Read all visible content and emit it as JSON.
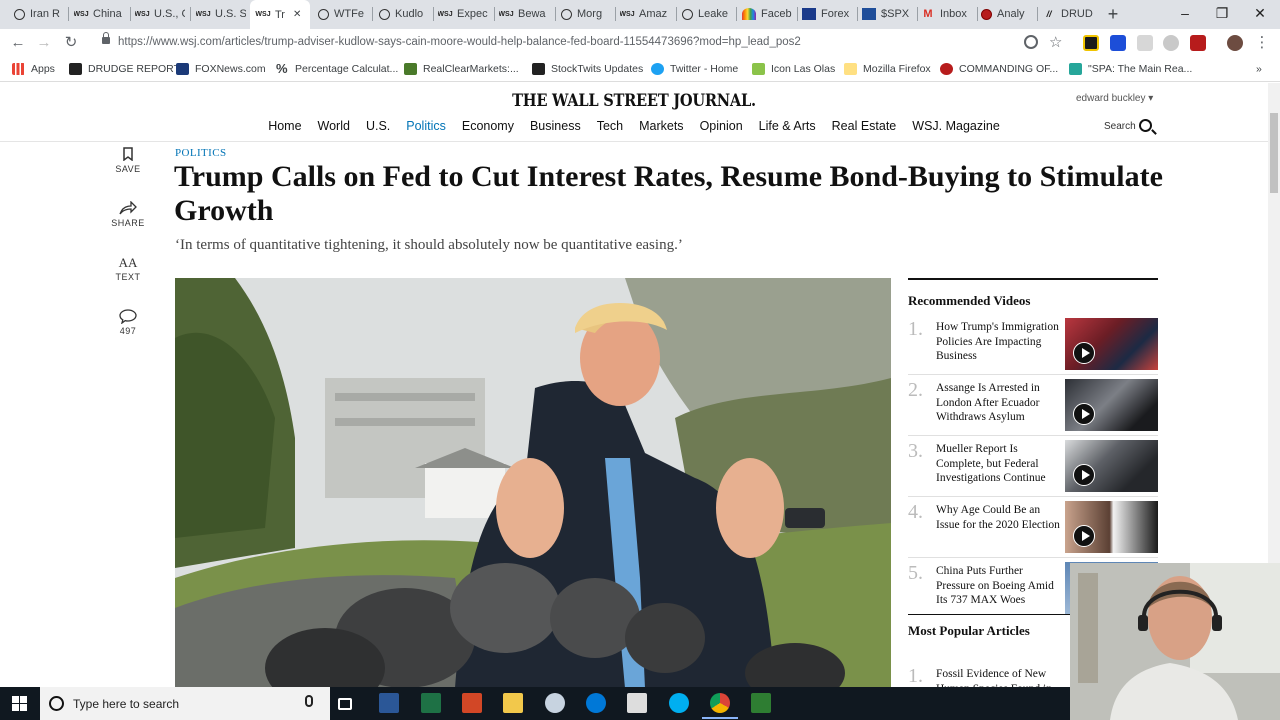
{
  "browser": {
    "tabs": [
      {
        "label": "Iran R"
      },
      {
        "label": "China"
      },
      {
        "label": "U.S., C"
      },
      {
        "label": "U.S. St"
      },
      {
        "label": "Tr"
      },
      {
        "label": "WTFe"
      },
      {
        "label": "Kudlo"
      },
      {
        "label": "Expec"
      },
      {
        "label": "Bewa"
      },
      {
        "label": "Morg"
      },
      {
        "label": "Amaz"
      },
      {
        "label": "Leake"
      },
      {
        "label": "Faceb"
      },
      {
        "label": "Forex"
      },
      {
        "label": "$SPX"
      },
      {
        "label": "Inbox"
      },
      {
        "label": "Analy"
      },
      {
        "label": "DRUD"
      }
    ],
    "tab_close_glyph": "✕",
    "new_tab_glyph": "+",
    "url": "https://www.wsj.com/articles/trump-adviser-kudlow-says-cain-moore-would-help-balance-fed-board-11554473696?mod=hp_lead_pos2",
    "bookmarks": [
      {
        "label": "Apps",
        "color": "#4285f4"
      },
      {
        "label": "DRUDGE REPORT",
        "color": "#222222"
      },
      {
        "label": "FOXNews.com",
        "color": "#1b3a78"
      },
      {
        "label": "Percentage Calculat...",
        "color": "#333333"
      },
      {
        "label": "RealClearMarkets:...",
        "color": "#4a7a2a"
      },
      {
        "label": "StockTwits Updates",
        "color": "#222222"
      },
      {
        "label": "Twitter - Home",
        "color": "#1da1f2"
      },
      {
        "label": "Icon Las Olas",
        "color": "#8bc34a"
      },
      {
        "label": "Mozilla Firefox",
        "color": "#ffe082"
      },
      {
        "label": "COMMANDING OF...",
        "color": "#b71c1c"
      },
      {
        "label": "\"SPA: The Main Rea...",
        "color": "#26a69a"
      }
    ],
    "bookmarks_overflow": "»"
  },
  "wsj": {
    "logo": "THE WALL STREET JOURNAL.",
    "user": "edward buckley ▾",
    "nav": [
      "Home",
      "World",
      "U.S.",
      "Politics",
      "Economy",
      "Business",
      "Tech",
      "Markets",
      "Opinion",
      "Life & Arts",
      "Real Estate",
      "WSJ. Magazine"
    ],
    "nav_active": "Politics",
    "search_label": "Search",
    "tools": [
      {
        "icon": "bookmark-icon",
        "label": "SAVE"
      },
      {
        "icon": "share-icon",
        "label": "SHARE"
      },
      {
        "icon": "text-size-icon",
        "glyph": "AA",
        "label": "TEXT"
      },
      {
        "icon": "comment-icon",
        "label": "497"
      }
    ],
    "kicker": "POLITICS",
    "headline": "Trump Calls on Fed to Cut Interest Rates, Resume Bond-Buying to Stimulate Growth",
    "dek": "‘In terms of quantitative tightening, it should absolutely now be quantitative easing.’",
    "recommended_title": "Recommended Videos",
    "videos": [
      {
        "num": "1.",
        "title": "How Trump's Immigration Policies Are Impacting Business"
      },
      {
        "num": "2.",
        "title": "Assange Is Arrested in London After Ecuador Withdraws Asylum"
      },
      {
        "num": "3.",
        "title": "Mueller Report Is Complete, but Federal Investigations Continue"
      },
      {
        "num": "4.",
        "title": "Why Age Could Be an Issue for the 2020 Election"
      },
      {
        "num": "5.",
        "title": "China Puts Further Pressure on Boeing Amid Its 737 MAX Woes"
      }
    ],
    "most_popular_title": "Most Popular Articles",
    "popular": [
      {
        "num": "1.",
        "title": "Fossil Evidence of New Human Species Found in"
      }
    ]
  },
  "taskbar": {
    "search_placeholder": "Type here to search"
  }
}
